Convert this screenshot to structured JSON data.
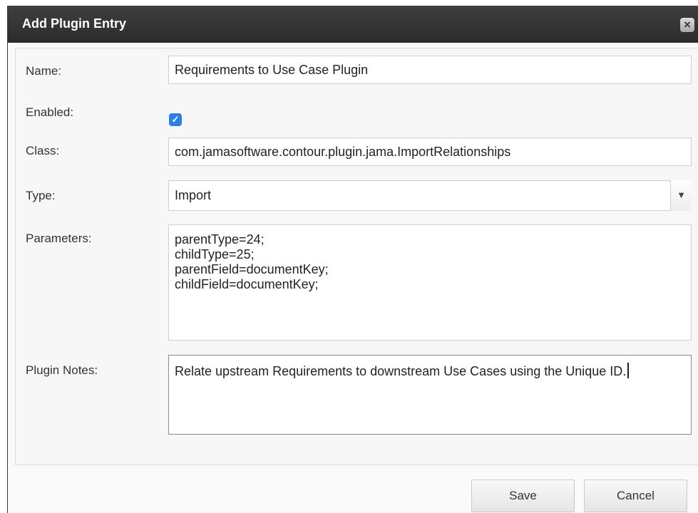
{
  "dialog": {
    "title": "Add Plugin Entry",
    "close_icon": "close-icon"
  },
  "form": {
    "name_label": "Name:",
    "name_value": "Requirements to Use Case Plugin",
    "enabled_label": "Enabled:",
    "enabled_checked": true,
    "class_label": "Class:",
    "class_value": "com.jamasoftware.contour.plugin.jama.ImportRelationships",
    "type_label": "Type:",
    "type_value": "Import",
    "parameters_label": "Parameters:",
    "parameters_value": "parentType=24;\nchildType=25;\nparentField=documentKey;\nchildField=documentKey;",
    "notes_label": "Plugin Notes:",
    "notes_value": "Relate upstream Requirements to downstream Use Cases using the Unique ID."
  },
  "buttons": {
    "save": "Save",
    "cancel": "Cancel"
  },
  "colors": {
    "titlebar": "#333333",
    "checkbox": "#2f7fe0"
  }
}
